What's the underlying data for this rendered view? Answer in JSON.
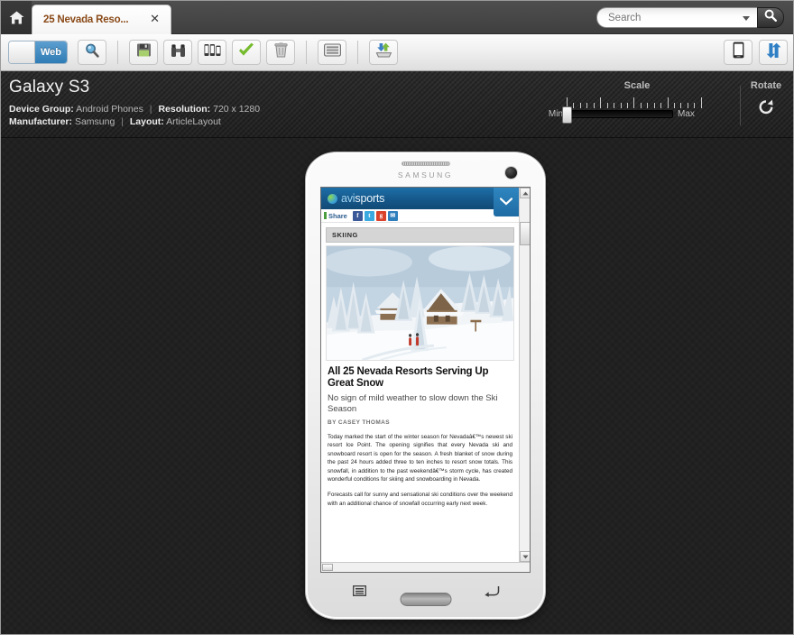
{
  "window": {
    "home_icon": "home-icon",
    "tab": {
      "title": "25 Nevada Reso...",
      "close": "✕"
    },
    "search": {
      "placeholder": "Search",
      "value": "",
      "icon": "search-icon",
      "dropdown_icon": "chevron-down-icon"
    }
  },
  "toolbar": {
    "mode_toggle": {
      "label": "Web",
      "state": "on"
    },
    "buttons": [
      {
        "name": "preview-search-button",
        "icon": "magnifier-icon",
        "label": ""
      },
      {
        "name": "save-button",
        "icon": "floppy-disk-icon",
        "label": ""
      },
      {
        "name": "compare-button",
        "icon": "binoculars-icon",
        "label": ""
      },
      {
        "name": "devices-button",
        "icon": "multi-device-icon",
        "label": ""
      },
      {
        "name": "approve-button",
        "icon": "green-check-icon",
        "label": ""
      },
      {
        "name": "delete-button",
        "icon": "trash-icon",
        "label": ""
      },
      {
        "name": "list-view-button",
        "icon": "list-rows-icon",
        "label": ""
      },
      {
        "name": "import-button",
        "icon": "import-arrows-icon",
        "label": ""
      },
      {
        "name": "mobile-preview-button",
        "icon": "smartphone-icon",
        "label": ""
      },
      {
        "name": "sync-button",
        "icon": "sync-arrows-icon",
        "label": ""
      }
    ]
  },
  "device": {
    "name": "Galaxy S3",
    "group_label": "Device Group:",
    "group_value": "Android Phones",
    "resolution_label": "Resolution:",
    "resolution_value": "720 x 1280",
    "manufacturer_label": "Manufacturer:",
    "manufacturer_value": "Samsung",
    "layout_label": "Layout:",
    "layout_value": "ArticleLayout",
    "separator": "|",
    "brand": "SAMSUNG"
  },
  "scale": {
    "title": "Scale",
    "min_label": "Min",
    "max_label": "Max",
    "value_percent": 0
  },
  "rotate": {
    "title": "Rotate",
    "icon": "rotate-cw-icon"
  },
  "phone_keys": {
    "menu_icon": "menu-key-icon",
    "home_icon": "home-key-icon",
    "back_icon": "back-key-icon"
  },
  "page": {
    "site_name_part1": "avi",
    "site_name_part2": "sports",
    "logo_icon": "avisports-swirl-icon",
    "header_chevron_icon": "chevron-down-icon",
    "share": {
      "label": "Share",
      "bookmark_icon": "bookmark-icon",
      "networks": [
        {
          "name": "facebook-share-icon",
          "glyph": "f"
        },
        {
          "name": "twitter-share-icon",
          "glyph": "t"
        },
        {
          "name": "googleplus-share-icon",
          "glyph": "g"
        },
        {
          "name": "email-share-icon",
          "glyph": "✉"
        }
      ]
    },
    "kicker": "SKIING",
    "image_alt": "Snow-covered ski lodges among pine trees with two skiers",
    "headline": "All 25 Nevada Resorts Serving Up Great Snow",
    "subhead": "No sign of mild weather to slow down the Ski Season",
    "byline": "BY CASEY THOMAS",
    "paragraphs": [
      "Today marked the start of the winter season for Nevadaâ€™s newest ski resort Ice Point. The opening signifies that every Nevada ski and snowboard resort is open for the season. A fresh blanket of snow during the past 24 hours added three to ten inches to resort snow totals. This snowfall, in addition to the past weekendâ€™s storm cycle, has created wonderful conditions for skiing and snowboarding in Nevada.",
      "Forecasts call for sunny and sensational ski conditions over the weekend with an additional chance of snowfall occurring early next week."
    ]
  }
}
